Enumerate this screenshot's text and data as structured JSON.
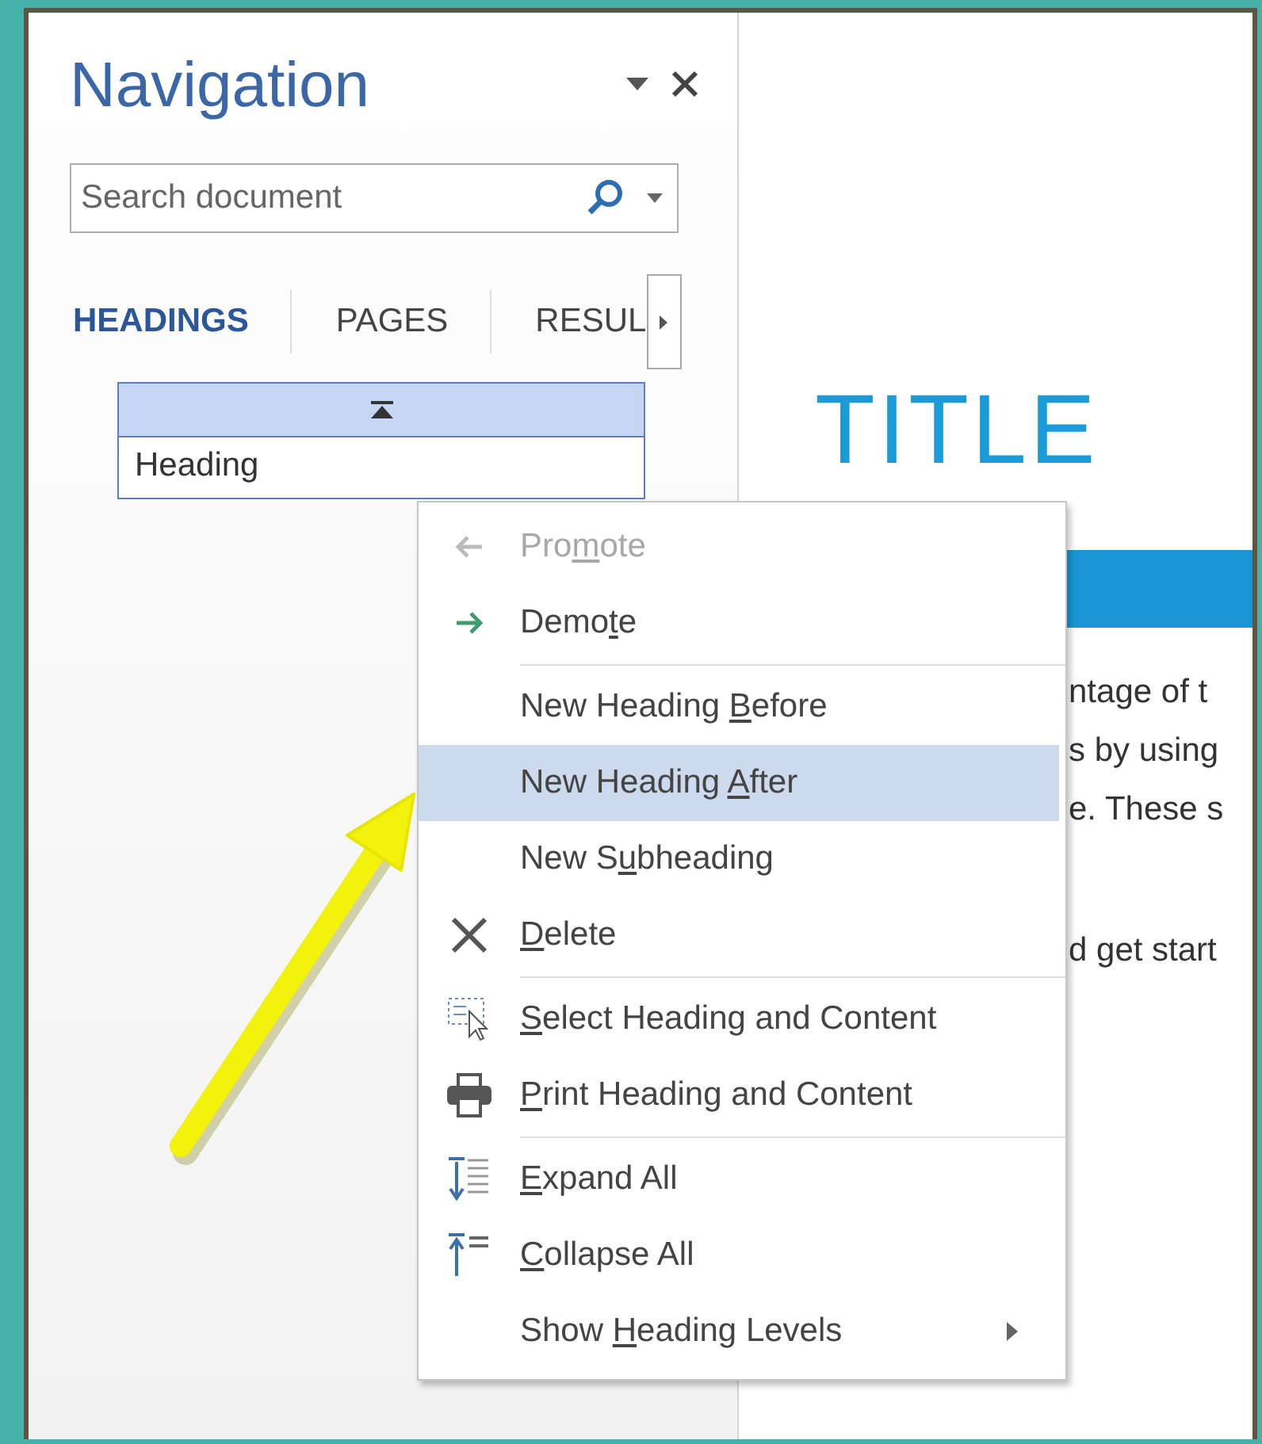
{
  "pane": {
    "title": "Navigation",
    "search": {
      "placeholder": "Search document"
    },
    "tabs": [
      {
        "label": "HEADINGS",
        "selected": true
      },
      {
        "label": "PAGES",
        "selected": false
      },
      {
        "label": "RESUL",
        "selected": false
      }
    ],
    "headings": [
      {
        "label": "Heading"
      }
    ]
  },
  "document": {
    "title": "TITLE",
    "paragraphs": [
      [
        "ntage of t",
        "s by using",
        "e. These s"
      ],
      [
        "d get start"
      ]
    ]
  },
  "context_menu": [
    {
      "kind": "item",
      "before": "Pro",
      "key": "m",
      "after": "ote",
      "disabled": true,
      "selected": false,
      "submenu": false
    },
    {
      "kind": "item",
      "before": "Demo",
      "key": "t",
      "after": "e",
      "disabled": false,
      "selected": false,
      "submenu": false
    },
    {
      "kind": "separator"
    },
    {
      "kind": "item",
      "before": "New Heading ",
      "key": "B",
      "after": "efore",
      "disabled": false,
      "selected": false,
      "submenu": false
    },
    {
      "kind": "item",
      "before": "New Heading ",
      "key": "A",
      "after": "fter",
      "disabled": false,
      "selected": true,
      "submenu": false
    },
    {
      "kind": "item",
      "before": "New S",
      "key": "u",
      "after": "bheading",
      "disabled": false,
      "selected": false,
      "submenu": false
    },
    {
      "kind": "item",
      "key": "D",
      "after": "elete",
      "disabled": false,
      "selected": false,
      "submenu": false
    },
    {
      "kind": "separator"
    },
    {
      "kind": "item",
      "key": "S",
      "after": "elect Heading and Content",
      "disabled": false,
      "selected": false,
      "submenu": false
    },
    {
      "kind": "item",
      "key": "P",
      "after": "rint Heading and Content",
      "disabled": false,
      "selected": false,
      "submenu": false
    },
    {
      "kind": "separator"
    },
    {
      "kind": "item",
      "key": "E",
      "after": "xpand All",
      "disabled": false,
      "selected": false,
      "submenu": false
    },
    {
      "kind": "item",
      "key": "C",
      "after": "ollapse All",
      "disabled": false,
      "selected": false,
      "submenu": false
    },
    {
      "kind": "item",
      "before": "Show ",
      "key": "H",
      "after": "eading Levels",
      "disabled": false,
      "selected": false,
      "submenu": true
    }
  ]
}
